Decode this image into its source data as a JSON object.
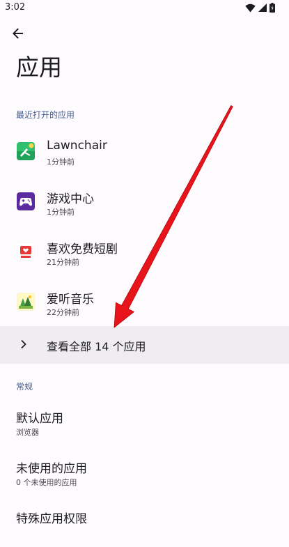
{
  "status_bar": {
    "time": "3:02"
  },
  "header": {
    "title": "应用"
  },
  "recent": {
    "section_label": "最近打开的应用",
    "apps": [
      {
        "name": "Lawnchair",
        "time": "1分钟前",
        "icon": "lawnchair-icon"
      },
      {
        "name": "游戏中心",
        "time": "1分钟前",
        "icon": "gamepad-icon"
      },
      {
        "name": "喜欢免费短剧",
        "time": "21分钟前",
        "icon": "short-drama-icon"
      },
      {
        "name": "爱听音乐",
        "time": "22分钟前",
        "icon": "music-icon"
      }
    ],
    "see_all_label": "查看全部 14 个应用"
  },
  "general": {
    "section_label": "常规",
    "items": [
      {
        "title": "默认应用",
        "subtitle": "浏览器"
      },
      {
        "title": "未使用的应用",
        "subtitle": "0 个未使用的应用"
      },
      {
        "title": "特殊应用权限",
        "subtitle": ""
      }
    ]
  },
  "colors": {
    "accent": "#445e91",
    "annotation_arrow": "#e8141b",
    "highlight_row": "#efedf0"
  }
}
